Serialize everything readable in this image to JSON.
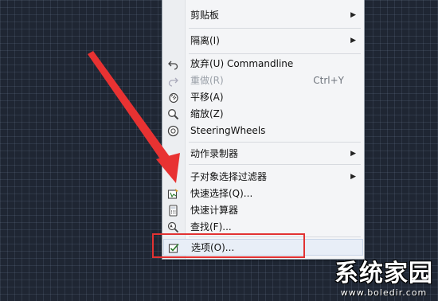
{
  "menu": {
    "items": [
      {
        "label": "",
        "icon": "none"
      },
      {
        "label": "剪贴板",
        "icon": "none",
        "submenu": true
      },
      {
        "label": "隔离(I)",
        "icon": "none",
        "submenu": true
      },
      {
        "label": "放弃(U) Commandline",
        "icon": "undo-icon"
      },
      {
        "label": "重做(R)",
        "shortcut": "Ctrl+Y",
        "icon": "redo-icon",
        "disabled": true
      },
      {
        "label": "平移(A)",
        "icon": "pan-hand-icon"
      },
      {
        "label": "缩放(Z)",
        "icon": "zoom-icon"
      },
      {
        "label": "SteeringWheels",
        "icon": "steering-wheel-icon"
      },
      {
        "label": "动作录制器",
        "icon": "none",
        "submenu": true
      },
      {
        "label": "子对象选择过滤器",
        "icon": "none",
        "submenu": true
      },
      {
        "label": "快速选择(Q)...",
        "icon": "quick-select-icon"
      },
      {
        "label": "快速计算器",
        "icon": "calculator-icon"
      },
      {
        "label": "查找(F)...",
        "icon": "find-text-icon"
      },
      {
        "label": "选项(O)...",
        "icon": "options-checkbox-icon",
        "hovered": true
      }
    ],
    "submenu_arrow": "▶"
  },
  "annotation": {
    "color": "#e23232"
  },
  "watermark": {
    "title": "系统家园",
    "url": "www.boledir.com"
  }
}
